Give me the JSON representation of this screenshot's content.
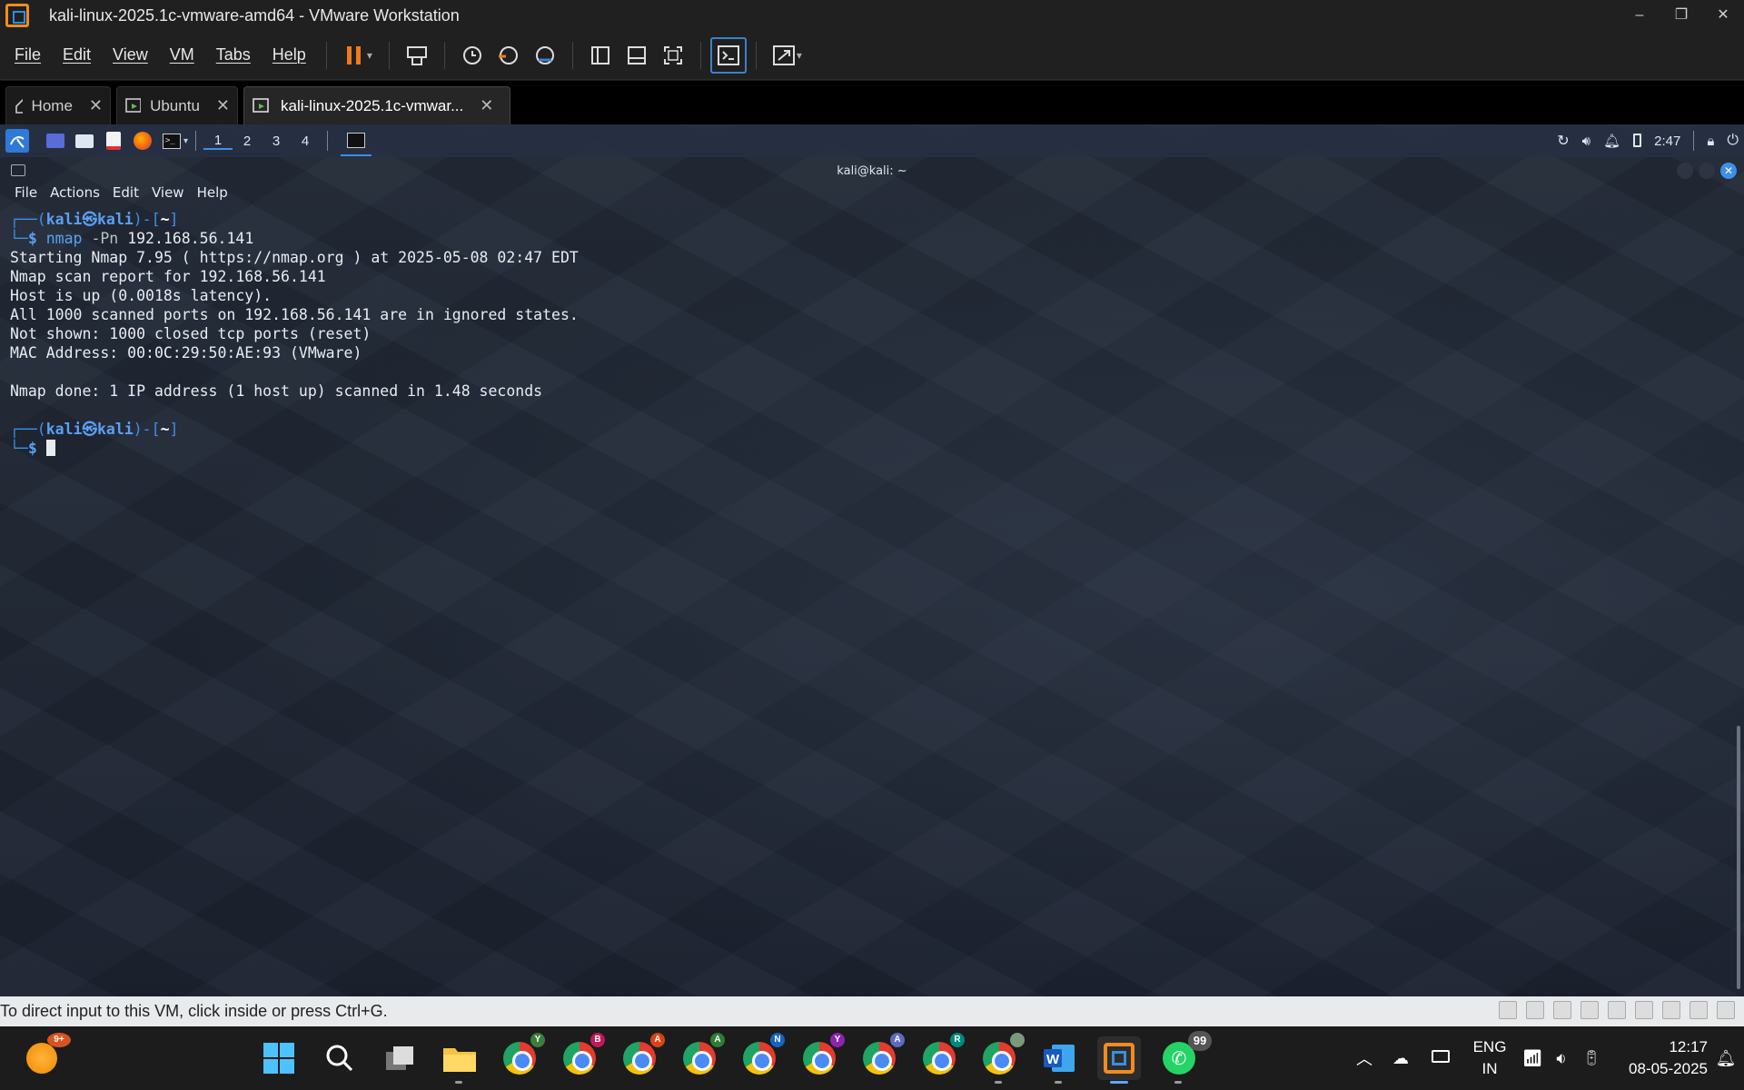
{
  "window": {
    "title": "kali-linux-2025.1c-vmware-amd64 - VMware Workstation",
    "controls": [
      "–",
      "❐",
      "✕"
    ]
  },
  "menu": {
    "file": "File",
    "edit": "Edit",
    "view": "View",
    "vm": "VM",
    "tabs": "Tabs",
    "help": "Help"
  },
  "tabs": [
    {
      "label": "Home",
      "icon": "home-icon"
    },
    {
      "label": "Ubuntu",
      "icon": "vm-icon"
    },
    {
      "label": "kali-linux-2025.1c-vmwar...",
      "icon": "vm-icon",
      "active": true
    }
  ],
  "kali_panel": {
    "workspaces": [
      "1",
      "2",
      "3",
      "4"
    ],
    "time": "2:47"
  },
  "terminal": {
    "title": "kali@kali: ~",
    "menu": [
      "File",
      "Actions",
      "Edit",
      "View",
      "Help"
    ],
    "prompt_user": "kali",
    "prompt_at": "㉿",
    "prompt_host": "kali",
    "prompt_dir": "~",
    "command": "nmap",
    "command_opt": "-Pn",
    "command_arg": "192.168.56.141",
    "output": [
      "Starting Nmap 7.95 ( https://nmap.org ) at 2025-05-08 02:47 EDT",
      "Nmap scan report for 192.168.56.141",
      "Host is up (0.0018s latency).",
      "All 1000 scanned ports on 192.168.56.141 are in ignored states.",
      "Not shown: 1000 closed tcp ports (reset)",
      "MAC Address: 00:0C:29:50:AE:93 (VMware)",
      "",
      "Nmap done: 1 IP address (1 host up) scanned in 1.48 seconds"
    ]
  },
  "status": {
    "hint": "To direct input to this VM, click inside or press Ctrl+G."
  },
  "taskbar": {
    "weather_badge": "9+",
    "chrome_profiles": [
      "Y",
      "B",
      "A",
      "A",
      "N",
      "Y",
      "A",
      "R",
      ""
    ],
    "whatsapp_badge": "99",
    "lang_line1": "ENG",
    "lang_line2": "IN",
    "clock_time": "12:17",
    "clock_date": "08-05-2025"
  },
  "colors": {
    "accent": "#3d8fe8",
    "vmware_orange": "#f08c1e",
    "pause_orange": "#f07a1a"
  }
}
